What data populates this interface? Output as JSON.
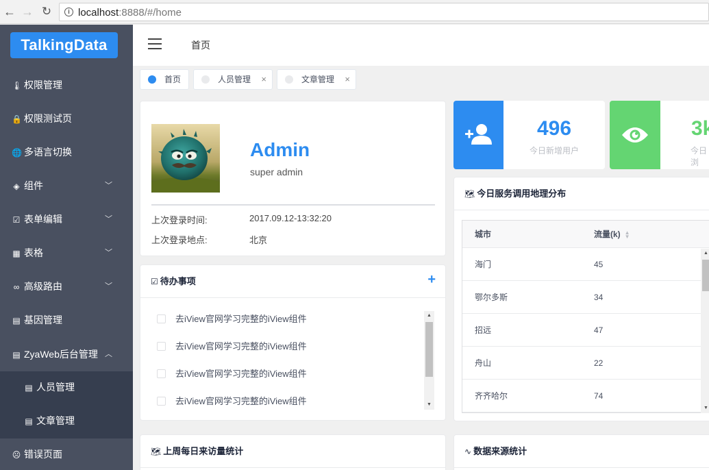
{
  "browser": {
    "url_host": "localhost",
    "url_rest": ":8888/#/home"
  },
  "sidebar": {
    "logo": "TalkingData",
    "items": [
      {
        "label": "权限管理",
        "icon": "thermometer-icon",
        "glyph": "🌡"
      },
      {
        "label": "权限测试页",
        "icon": "lock-icon",
        "glyph": "🔒"
      },
      {
        "label": "多语言切换",
        "icon": "globe-icon",
        "glyph": "🌐"
      },
      {
        "label": "组件",
        "icon": "layers-icon",
        "glyph": "◈"
      },
      {
        "label": "表单编辑",
        "icon": "checkbox-icon",
        "glyph": "☑"
      },
      {
        "label": "表格",
        "icon": "grid-icon",
        "glyph": "▦"
      },
      {
        "label": "高级路由",
        "icon": "infinity-icon",
        "glyph": "∞"
      },
      {
        "label": "基因管理",
        "icon": "document-icon",
        "glyph": "▤"
      },
      {
        "label": "ZyaWeb后台管理",
        "icon": "clipboard-icon",
        "glyph": "▤"
      }
    ],
    "subitems": [
      {
        "label": "人员管理",
        "icon": "document-icon",
        "glyph": "▤"
      },
      {
        "label": "文章管理",
        "icon": "document-icon",
        "glyph": "▤"
      }
    ],
    "last_item": {
      "label": "错误页面",
      "icon": "sad-face-icon",
      "glyph": "☹"
    }
  },
  "topbar": {
    "breadcrumb": "首页"
  },
  "tags": [
    {
      "label": "首页"
    },
    {
      "label": "人员管理"
    },
    {
      "label": "文章管理"
    }
  ],
  "user": {
    "name": "Admin",
    "role": "super admin",
    "last_login_time_label": "上次登录时间:",
    "last_login_time": "2017.09.12-13:32:20",
    "last_login_place_label": "上次登录地点:",
    "last_login_place": "北京"
  },
  "todo": {
    "title": "待办事项",
    "items": [
      "去iView官网学习完整的iView组件",
      "去iView官网学习完整的iView组件",
      "去iView官网学习完整的iView组件",
      "去iView官网学习完整的iView组件"
    ]
  },
  "stats": [
    {
      "value": "496",
      "label": "今日新增用户",
      "color": "#2d8cf0",
      "icon": "add-user-icon"
    },
    {
      "value": "3k",
      "label": "今日浏",
      "color": "#64d572",
      "icon": "eye-icon"
    }
  ],
  "geo": {
    "title": "今日服务调用地理分布",
    "columns": [
      "城市",
      "流量(k)"
    ],
    "rows": [
      {
        "city": "海门",
        "value": "45"
      },
      {
        "city": "鄂尔多斯",
        "value": "34"
      },
      {
        "city": "招远",
        "value": "47"
      },
      {
        "city": "舟山",
        "value": "22"
      },
      {
        "city": "齐齐哈尔",
        "value": "74"
      }
    ]
  },
  "bottom": {
    "weekly_title": "上周每日来访量统计",
    "source_title": "数据来源统计"
  }
}
